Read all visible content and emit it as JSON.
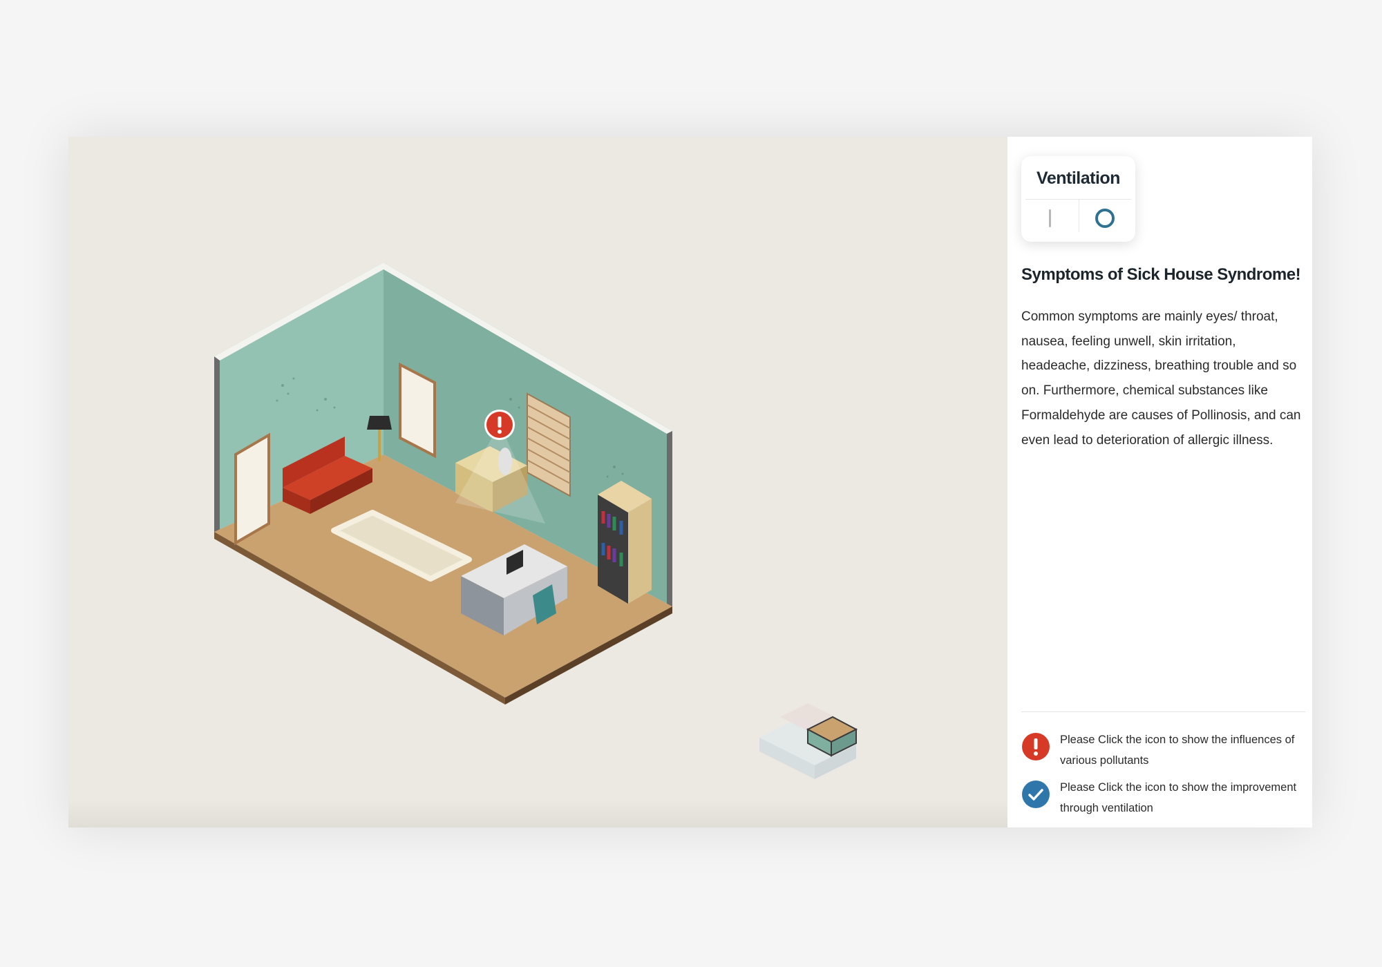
{
  "ventilation": {
    "title": "Ventilation",
    "off_icon": "bar-icon",
    "on_icon": "ring-icon",
    "selected": "on"
  },
  "info": {
    "heading": "Symptoms of Sick House Syndrome!",
    "body": "Common symptoms are mainly eyes/ throat, nausea, feeling unwell, skin irritation, headeache, dizziness, breathing trouble and so on. Furthermore, chemical substances like Formaldehyde are causes of Pollinosis, and can even lead to deterioration of allergic illness."
  },
  "legend": [
    {
      "icon": "exclamation-icon",
      "text": "Please Click the icon to show the influences of various pollutants"
    },
    {
      "icon": "checkmark-icon",
      "text": "Please Click the icon to show the improvement through ventilation"
    }
  ],
  "colors": {
    "alert_red": "#d63a26",
    "check_blue": "#2f77ab",
    "accent_teal": "#2e7191",
    "wall": "#8dbdb0",
    "floor": "#c9a270",
    "background": "#ece9e2"
  }
}
